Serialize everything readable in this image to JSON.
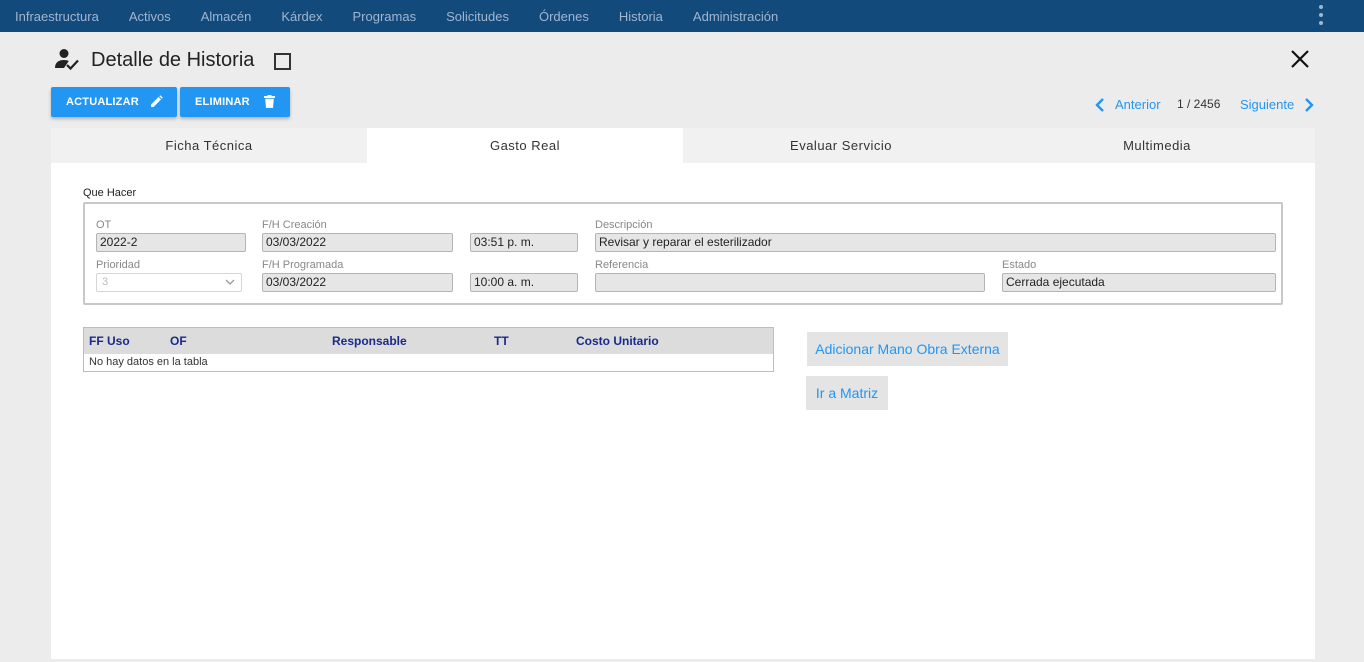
{
  "nav": {
    "items": [
      "Infraestructura",
      "Activos",
      "Almacén",
      "Kárdex",
      "Programas",
      "Solicitudes",
      "Órdenes",
      "Historia",
      "Administración"
    ]
  },
  "header": {
    "title": "Detalle de Historia"
  },
  "actions": {
    "update_label": "ACTUALIZAR",
    "delete_label": "ELIMINAR"
  },
  "pager": {
    "prev_label": "Anterior",
    "count": "1 / 2456",
    "next_label": "Siguiente"
  },
  "tabs": [
    {
      "label": "Ficha Técnica"
    },
    {
      "label": "Gasto Real"
    },
    {
      "label": "Evaluar Servicio"
    },
    {
      "label": "Multimedia"
    }
  ],
  "form": {
    "section_label": "Que Hacer",
    "ot_label": "OT",
    "ot_value": "2022-2",
    "creation_label": "F/H Creación",
    "creation_date": "03/03/2022",
    "creation_time": "03:51 p. m.",
    "description_label": "Descripción",
    "description_value": "Revisar y reparar el esterilizador",
    "priority_label": "Prioridad",
    "priority_value": "3",
    "scheduled_label": "F/H Programada",
    "scheduled_date": "03/03/2022",
    "scheduled_time": "10:00 a. m.",
    "reference_label": "Referencia",
    "reference_value": "",
    "status_label": "Estado",
    "status_value": "Cerrada ejecutada"
  },
  "table": {
    "columns": [
      "FF Uso",
      "OF",
      "Responsable",
      "TT",
      "Costo Unitario"
    ],
    "empty_text": "No hay datos en la tabla"
  },
  "side_buttons": {
    "external_label": "Adicionar Mano Obra Externa",
    "matrix_label": "Ir a Matriz"
  },
  "colors": {
    "nav_bg": "#134a7c",
    "accent": "#2196f3",
    "table_header_text": "#1a2a8a"
  }
}
